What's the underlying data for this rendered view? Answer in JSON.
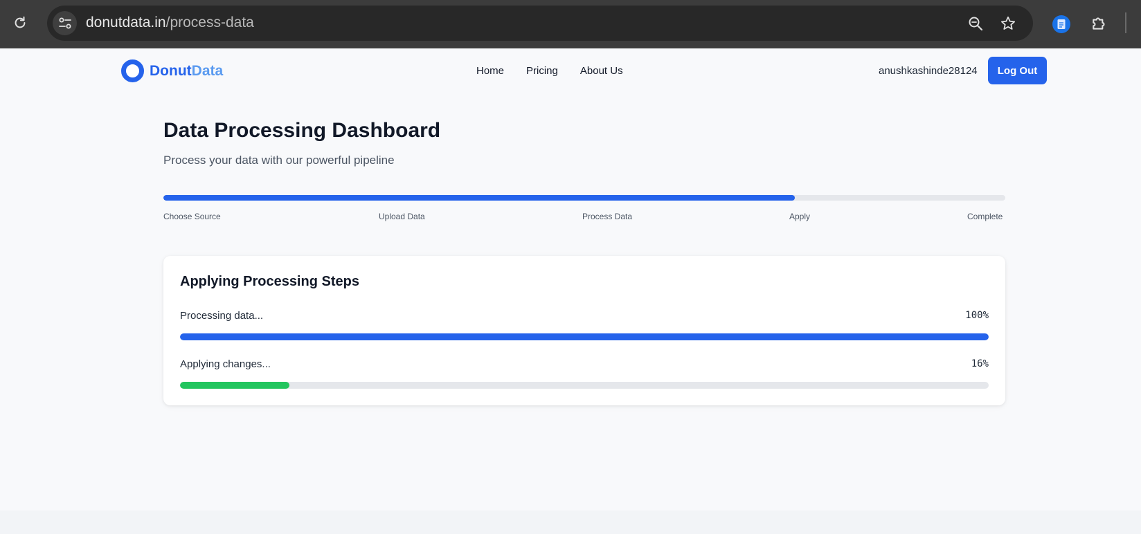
{
  "browser": {
    "url_domain": "donutdata.in",
    "url_path": "/process-data"
  },
  "nav": {
    "logo_main": "Donut",
    "logo_accent": "Data",
    "links": [
      "Home",
      "Pricing",
      "About Us"
    ],
    "username": "anushkashinde28124",
    "logout_label": "Log Out"
  },
  "header": {
    "title": "Data Processing Dashboard",
    "subtitle": "Process your data with our powerful pipeline"
  },
  "stepper": {
    "progress": 0.75,
    "active_index": 3,
    "steps": [
      "Choose Source",
      "Upload Data",
      "Process Data",
      "Apply",
      "Complete"
    ]
  },
  "card": {
    "title": "Applying Processing Steps",
    "tasks": [
      {
        "label": "Processing data...",
        "percent_text": "100%",
        "progress": 1.0,
        "color": "#2563eb"
      },
      {
        "label": "Applying changes...",
        "percent_text": "16%",
        "progress": 0.135,
        "color": "#22c55e"
      }
    ]
  },
  "colors": {
    "primary": "#2563eb",
    "success": "#22c55e",
    "track": "#e5e7eb"
  },
  "icons": [
    "reload-icon",
    "site-info-icon",
    "zoom-icon",
    "star-icon",
    "doc-extension-icon",
    "puzzle-icon"
  ]
}
